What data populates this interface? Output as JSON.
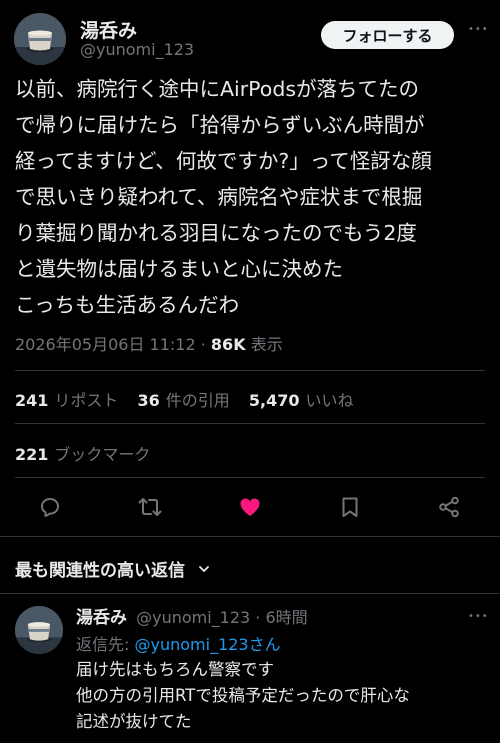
{
  "tweet": {
    "author_name": "湯呑み",
    "author_handle": "@yunomi_123",
    "follow_label": "フォローする",
    "more_label": "•••",
    "body": "以前、病院行く途中にAirPodsが落ちてたの\nで帰りに届けたら「拾得からずいぶん時間が\n経ってますけど、何故ですか?」って怪訝な顔\nで思いきり疑われて、病院名や症状まで根掘\nり葉掘り聞かれる羽目になったのでもう2度\nと遺失物は届けるまいと心に決めた\nこっちも生活あるんだわ",
    "timestamp": "2026年05月06日 11:12",
    "separator": "·",
    "views_count": "86K",
    "views_label": "表示"
  },
  "stats": {
    "reposts_count": "241",
    "reposts_label": "リポスト",
    "quotes_count": "36",
    "quotes_label": "件の引用",
    "likes_count": "5,470",
    "likes_label": "いいね",
    "bookmarks_count": "221",
    "bookmarks_label": "ブックマーク"
  },
  "actions": {
    "reply_icon": "reply-icon",
    "repost_icon": "repost-icon",
    "like_icon": "heart-icon",
    "bookmark_icon": "bookmark-icon",
    "share_icon": "share-icon",
    "like_color": "#f91880"
  },
  "replies_sort": {
    "label": "最も関連性の高い返信",
    "chevron": "⌄"
  },
  "reply": {
    "author_name": "湯呑み",
    "author_handle": "@yunomi_123",
    "time": "· 6時間",
    "more_label": "•••",
    "reply_to_prefix": "返信先:",
    "reply_to_handle": "@yunomi_123さん",
    "body": "届け先はもちろん警察です\n他の方の引用RTで投稿予定だったので肝心な\n記述が抜けてた"
  },
  "colors": {
    "background": "#000000",
    "text": "#e7e9ea",
    "muted": "#71767b",
    "link": "#1d9bf0",
    "divider": "#2f3336"
  }
}
